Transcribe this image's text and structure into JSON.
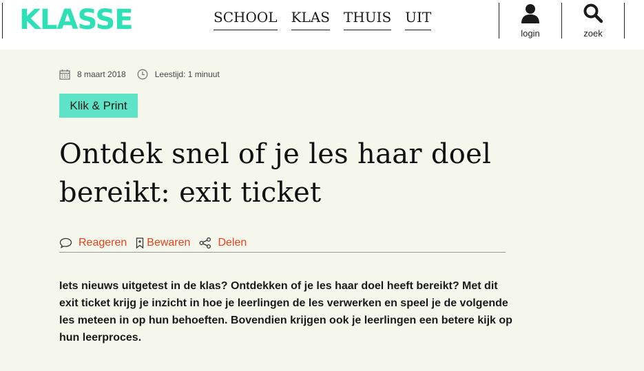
{
  "header": {
    "logo": "KLASSE",
    "nav": [
      "SCHOOL",
      "KLAS",
      "THUIS",
      "UIT"
    ],
    "login_label": "login",
    "search_label": "zoek"
  },
  "article": {
    "date": "8 maart 2018",
    "reading_time": "Leestijd: 1 minuut",
    "tag": "Klik & Print",
    "title": "Ontdek snel of je les haar doel bereikt: exit ticket",
    "actions": {
      "comment": "Reageren",
      "save": "Bewaren",
      "share": "Delen"
    },
    "intro": "Iets nieuws uitgetest in de klas? Ontdekken of je les haar doel heeft bereikt? Met dit exit ticket krijg je inzicht in hoe je leerlingen de les verwerken en speel je de volgende les meteen in op hun behoeften. Bovendien krijgen ook je leerlingen een betere kijk op hun leerproces."
  },
  "colors": {
    "brand": "#2ee0b5",
    "tag_bg": "#5fe3c6",
    "accent": "#e8411d",
    "page_bg": "#f6f7ec"
  },
  "icons": [
    "calendar-icon",
    "clock-icon",
    "user-icon",
    "search-icon",
    "comment-icon",
    "bookmark-icon",
    "share-icon"
  ]
}
